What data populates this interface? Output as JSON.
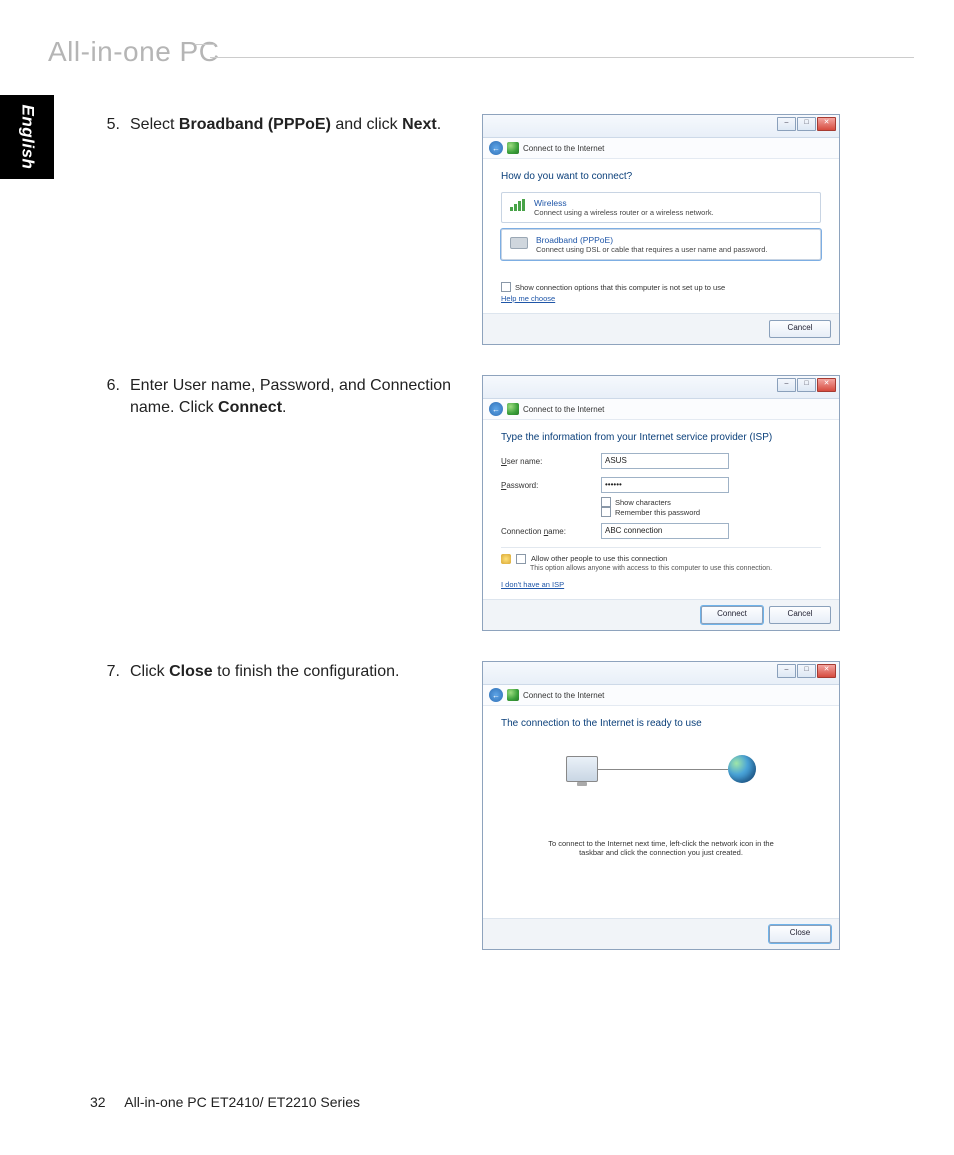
{
  "header": {
    "title": "All-in-one PC"
  },
  "langTab": "English",
  "steps": [
    {
      "num": "5.",
      "segments": [
        {
          "t": "Select ",
          "b": false
        },
        {
          "t": "Broadband (PPPoE)",
          "b": true
        },
        {
          "t": " and click ",
          "b": false
        },
        {
          "t": "Next",
          "b": true
        },
        {
          "t": ".",
          "b": false
        }
      ]
    },
    {
      "num": "6.",
      "segments": [
        {
          "t": "Enter User name, Password, and Connection name. Click ",
          "b": false
        },
        {
          "t": "Connect",
          "b": true
        },
        {
          "t": ".",
          "b": false
        }
      ]
    },
    {
      "num": "7.",
      "segments": [
        {
          "t": "Click ",
          "b": false
        },
        {
          "t": "Close",
          "b": true
        },
        {
          "t": " to finish the configuration.",
          "b": false
        }
      ]
    }
  ],
  "dialog1": {
    "navTitle": "Connect to the Internet",
    "heading": "How do you want to connect?",
    "optWireless": {
      "title": "Wireless",
      "desc": "Connect using a wireless router or a wireless network."
    },
    "optBroadband": {
      "title": "Broadband (PPPoE)",
      "desc": "Connect using DSL or cable that requires a user name and password."
    },
    "chkLabel": "Show connection options that this computer is not set up to use",
    "helpLink": "Help me choose",
    "btnCancel": "Cancel"
  },
  "dialog2": {
    "navTitle": "Connect to the Internet",
    "heading": "Type the information from your Internet service provider (ISP)",
    "userLabel": "User name:",
    "userValue": "ASUS",
    "passLabel": "Password:",
    "passValue": "••••••",
    "showChars": "Show characters",
    "remember": "Remember this password",
    "connNameLabel": "Connection name:",
    "connNameValue": "ABC connection",
    "allowLabel": "Allow other people to use this connection",
    "allowDesc": "This option allows anyone with access to this computer to use this connection.",
    "noIsp": "I don't have an ISP",
    "btnConnect": "Connect",
    "btnCancel": "Cancel"
  },
  "dialog3": {
    "navTitle": "Connect to the Internet",
    "heading": "The connection to the Internet is ready to use",
    "tip": "To connect to the Internet next time, left-click the network icon in the taskbar and click the connection you just created.",
    "btnClose": "Close"
  },
  "footer": {
    "pageNum": "32",
    "series": "All-in-one PC ET2410/ ET2210 Series"
  }
}
